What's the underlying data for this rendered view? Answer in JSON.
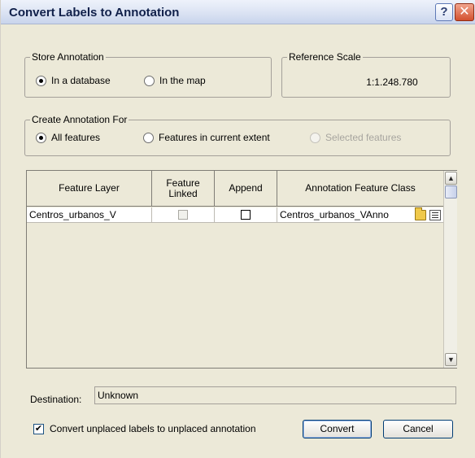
{
  "window": {
    "title": "Convert Labels to Annotation",
    "help_label": "?",
    "close_label": "✕"
  },
  "store_annotation": {
    "group_label": "Store Annotation",
    "options": [
      "In a database",
      "In the map"
    ],
    "selected": "In a database"
  },
  "reference_scale": {
    "group_label": "Reference Scale",
    "value": "1:1.248.780"
  },
  "create_annotation_for": {
    "group_label": "Create Annotation For",
    "options": [
      "All features",
      "Features in current extent",
      "Selected features"
    ],
    "selected": "All features",
    "disabled": [
      "Selected features"
    ]
  },
  "table": {
    "columns": [
      "Feature Layer",
      "Feature Linked",
      "Append",
      "Annotation Feature Class"
    ],
    "rows": [
      {
        "feature_layer": "Centros_urbanos_V",
        "feature_linked": false,
        "feature_linked_enabled": false,
        "append": false,
        "annotation_feature_class": "Centros_urbanos_VAnno"
      }
    ],
    "scroll_up_icon": "scroll-up-arrow",
    "scroll_down_icon": "scroll-down-arrow"
  },
  "destination": {
    "label": "Destination:",
    "value": "Unknown"
  },
  "options": {
    "convert_unplaced_label": "Convert unplaced labels to unplaced annotation",
    "convert_unplaced_checked": true
  },
  "buttons": {
    "convert": "Convert",
    "cancel": "Cancel"
  }
}
